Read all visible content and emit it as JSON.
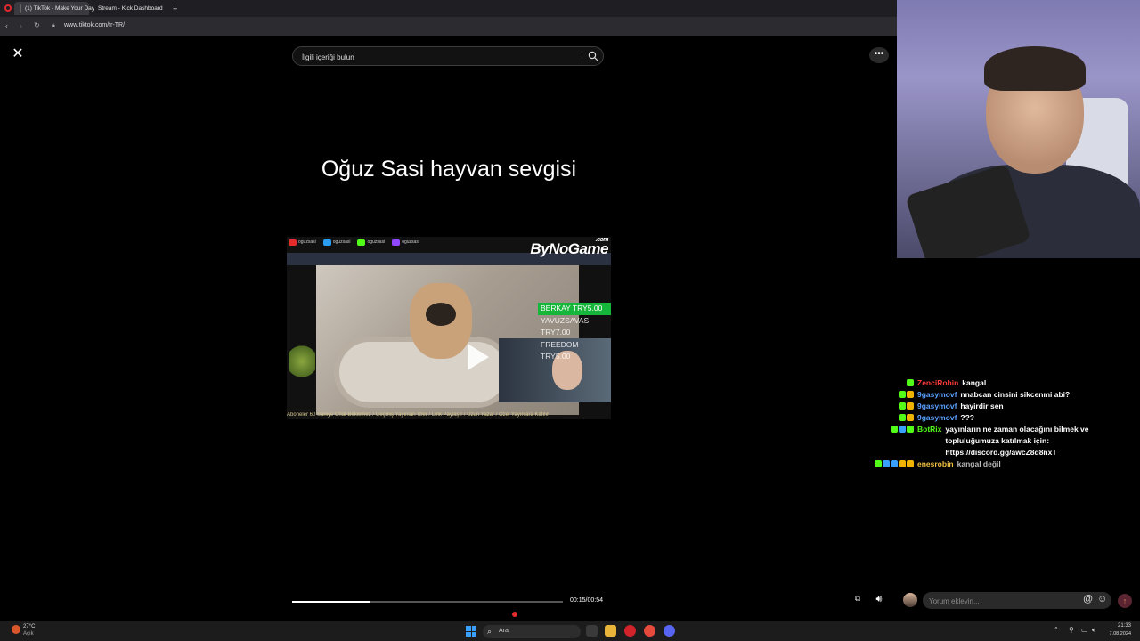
{
  "browser": {
    "tabs": [
      {
        "label": "(1) TikTok - Make Your Day",
        "active": true,
        "favicon_color": "#111111"
      },
      {
        "label": "Stream - Kick Dashboard",
        "active": false,
        "favicon_color": "#53fc18"
      }
    ],
    "new_tab": "+",
    "url": "www.tiktok.com/tr-TR/"
  },
  "tiktok": {
    "search": {
      "placeholder": "İlgili içeriği bulun"
    },
    "video_title": "Oğuz Sasi hayvan sevgisi",
    "overlay": {
      "socials": [
        "oguzsasi",
        "oguzsasi",
        "oguzsasi",
        "oguzsasi"
      ],
      "brand": "ByNoGame",
      "brand_suffix": ".com",
      "donations": [
        "BERKAY TRY5.00",
        "YAVUZSAVAS TRY7.00",
        "FREEDOM TRY5.00"
      ],
      "ticker": "Aboneler 60 Saniye Chat Beklemez / Geçmiş Yayınları İzler / Link Paylaşır / Uzun Yazar / Özel Yayınlara Katılır"
    },
    "progress": {
      "fraction": 0.29
    },
    "time": "00:15/00:54",
    "comment": {
      "placeholder": "Yorum ekleyin...",
      "at": "@",
      "emoji": "☺",
      "post": "↑"
    }
  },
  "chat": {
    "messages": [
      {
        "badges": [
          "#53fc18"
        ],
        "user": "ZenciRobin",
        "user_color": "#ff3b3b",
        "text": "kangal"
      },
      {
        "badges": [
          "#53fc18",
          "#f0b400"
        ],
        "user": "9gasymovf",
        "user_color": "#5aa0ff",
        "text": "nnabcan cinsini sikcenmi abi?"
      },
      {
        "badges": [
          "#53fc18",
          "#f0b400"
        ],
        "user": "9gasymovf",
        "user_color": "#5aa0ff",
        "text": "hayirdir sen"
      },
      {
        "badges": [
          "#53fc18",
          "#f0b400"
        ],
        "user": "9gasymovf",
        "user_color": "#5aa0ff",
        "text": "???"
      },
      {
        "badges": [
          "#53fc18",
          "#3aa0ff",
          "#53fc18"
        ],
        "user": "BotRix",
        "user_color": "#53fc18",
        "text": "yayınların ne zaman olacağını bilmek ve topluluğumuza katılmak için: https://discord.gg/awcZ8d8nxT"
      },
      {
        "badges": [
          "#53fc18",
          "#3aa0ff",
          "#3aa0ff",
          "#f0b400",
          "#f0b400"
        ],
        "user": "enesrobin",
        "user_color": "#f0c040",
        "text": "kangal değil"
      }
    ]
  },
  "taskbar": {
    "weather": {
      "temp": "27°C",
      "condition": "Açık"
    },
    "search_label": "Ara",
    "time": "21:33",
    "date": "7.08.2024"
  }
}
